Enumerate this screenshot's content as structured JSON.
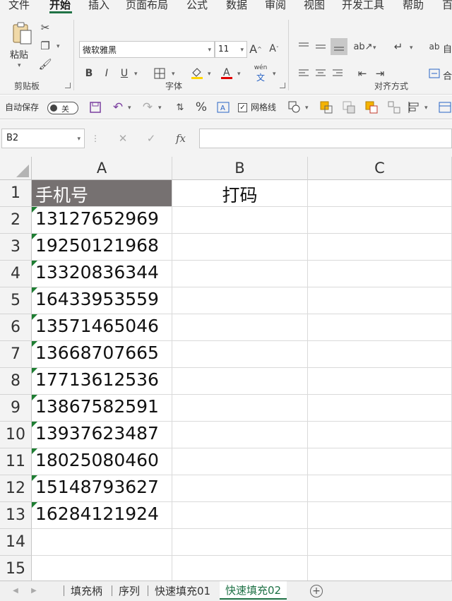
{
  "ribbon_tabs": [
    "文件",
    "开始",
    "插入",
    "页面布局",
    "公式",
    "数据",
    "审阅",
    "视图",
    "开发工具",
    "帮助",
    "百"
  ],
  "clipboard": {
    "paste_label": "粘贴",
    "group_label": "剪贴板"
  },
  "font": {
    "name": "微软雅黑",
    "size": "11",
    "group_label": "字体",
    "bold": "B",
    "italic": "I",
    "underline": "U",
    "phonetic": "wén"
  },
  "alignment": {
    "group_label": "对齐方式",
    "wrap_label": "自",
    "merge_label": "合"
  },
  "qat": {
    "autosave_label": "自动保存",
    "autosave_state": "关",
    "gridlines_label": "网格线",
    "percent": "%"
  },
  "formula_bar": {
    "name_box": "B2",
    "fx": "fx",
    "formula": ""
  },
  "grid": {
    "columns": [
      "A",
      "B",
      "C"
    ],
    "rows": [
      "1",
      "2",
      "3",
      "4",
      "5",
      "6",
      "7",
      "8",
      "9",
      "10",
      "11",
      "12",
      "13",
      "14",
      "15"
    ],
    "header_row": [
      "手机号",
      "打码"
    ],
    "phones": [
      "13127652969",
      "19250121968",
      "13320836344",
      "16433953559",
      "13571465046",
      "13668707665",
      "17713612536",
      "13867582591",
      "13937623487",
      "18025080460",
      "15148793627",
      "16284121924"
    ]
  },
  "sheet_tabs": [
    "填充柄",
    "序列",
    "快速填充01",
    "快速填充02"
  ],
  "active_sheet": "快速填充02",
  "colors": {
    "accent": "#217346",
    "header_fill": "#767171",
    "marker": "#1e7d32"
  }
}
